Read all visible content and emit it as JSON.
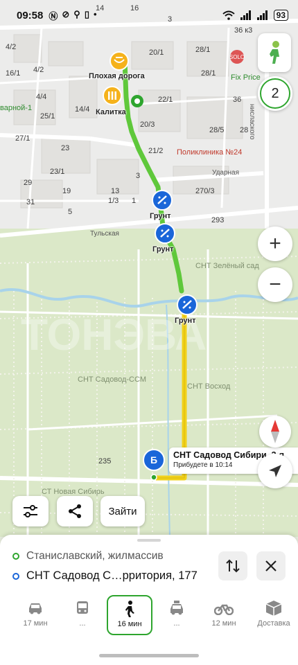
{
  "status": {
    "time": "09:58",
    "battery": "93"
  },
  "colors": {
    "accent_green": "#2ea52e",
    "route_walk_green": "#5fc83b",
    "route_yellow": "#f2d21b",
    "hazard_blue": "#1a66d9",
    "map_green": "#dfe9cc"
  },
  "map": {
    "labels": {
      "n14": "14",
      "n16": "16",
      "n3": "3",
      "n36k3": "36 к3",
      "n4_2a": "4/2",
      "n20_1": "20/1",
      "n28_1a": "28/1",
      "n4_2b": "4/2",
      "n16_1": "16/1",
      "n28_1b": "28/1",
      "n4_4": "4/4",
      "n14_4": "14/4",
      "n22_1": "22/1",
      "n36": "36",
      "n25_1": "25/1",
      "n20_3": "20/3",
      "n27_1": "27/1",
      "n28_5": "28/5",
      "n28": "28",
      "n23": "23",
      "n21_2": "21/2",
      "n23_1": "23/1",
      "n3b": "3",
      "n29": "29",
      "n19": "19",
      "n13": "13",
      "n270_3": "270/3",
      "n31": "31",
      "n5": "5",
      "n1_3": "1/3",
      "n1": "1",
      "n293": "293",
      "n235": "235",
      "poliklinika": "Поликлиника №24",
      "udarnaya": "Ударная",
      "tulskaya": "Тульская",
      "slavskogo": "нислаского",
      "fixprice": "Fix Price",
      "solo": "SOLO",
      "zvarnoy": "варной-1",
      "snt_zeleny": "СНТ Зелёный сад",
      "snt_ssm": "СНТ Садовод-ССМ",
      "snt_voskhod": "СНТ Восход",
      "st_novaya": "СТ Новая Сибирь",
      "tonsba": "ТОНЭВА"
    },
    "markers": {
      "plohaya_doroga": "Плохая дорога",
      "kalitka": "Калитка",
      "grunt1": "Грунт",
      "grunt2": "Грунт",
      "grunt3": "Грунт"
    },
    "counter_badge": "2",
    "destination": {
      "pin_letter": "Б",
      "title": "СНТ Садовод Сибири, 3-я",
      "eta": "Прибудете в 10:14"
    },
    "actions": {
      "enter_label": "Зайти"
    }
  },
  "route": {
    "from": "Станиславский, жилмассив",
    "to": "СНТ Садовод С…рритория, 177"
  },
  "modes": [
    {
      "name": "car",
      "label": "17 мин",
      "icon": "car-icon"
    },
    {
      "name": "bus",
      "label": "...",
      "icon": "bus-icon"
    },
    {
      "name": "walk",
      "label": "16 мин",
      "icon": "walker-icon",
      "active": true
    },
    {
      "name": "taxi",
      "label": "...",
      "icon": "taxi-icon"
    },
    {
      "name": "moto",
      "label": "12 мин",
      "icon": "motorcycle-icon"
    },
    {
      "name": "delivery",
      "label": "Доставка",
      "icon": "box-icon"
    }
  ]
}
